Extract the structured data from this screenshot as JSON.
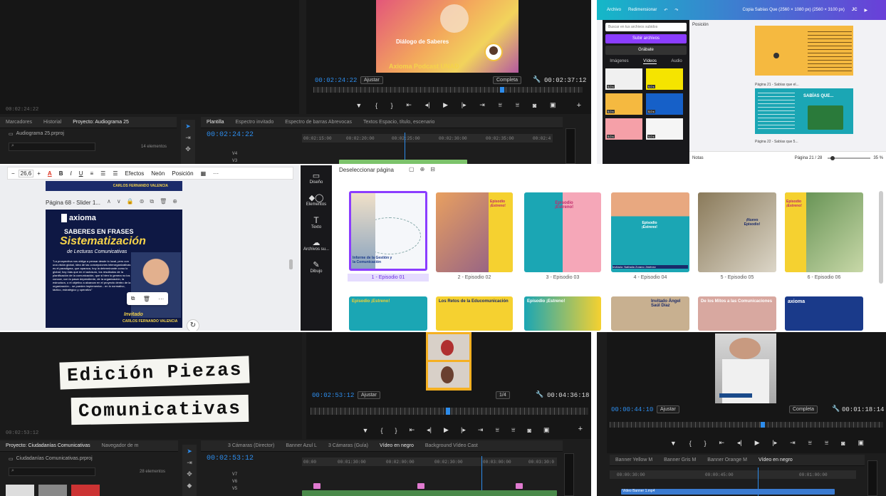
{
  "p1": {
    "program_time": "00:02:24:22",
    "program_title": "Diálogo de Saberes",
    "program_subtitle": "Axioma Podcast UNAD",
    "fit": "Ajustar",
    "quality": "Completa",
    "duration": "00:02:37:12",
    "source_time": "00:02:24:22",
    "tabs": [
      "Marcadores",
      "Historial",
      "Proyecto: Audiograma 25",
      "Plantilla",
      "Espectro invitado",
      "Espectro de barras Abrevocas",
      "Textos Espacio, título, escenario"
    ],
    "project_file": "Audiograma 25.prproj",
    "items": "14 elementos",
    "timeline_time": "00:02:24:22",
    "ruler": [
      "00:02:15:00",
      "00:02:20:00",
      "00:02:25:00",
      "00:02:30:00",
      "00:02:35:00",
      "00:02:4"
    ],
    "tracks": [
      "V4",
      "V3"
    ]
  },
  "p2": {
    "menu": [
      "Archivo",
      "Redimensionar"
    ],
    "doc_title": "Copia Sabías Que (2560 × 1080 px) (2560 × 3100 px)",
    "user": "JC",
    "search_placeholder": "Buscar en tus archivos subidos",
    "upload": "Subir archivos",
    "record": "Grábate",
    "tabs": [
      "Imágenes",
      "Vídeos",
      "Audio"
    ],
    "panel_label": "Posición",
    "badges": [
      "5,0 s",
      "5,0 s",
      "5,0 s",
      "5,0 s",
      "5,0 s",
      "5,0 s"
    ],
    "page21": "Página 21 - Sabías que el...",
    "page22": "Página 22 - Sabías que 5...",
    "sabias": "SABÍAS QUE...",
    "notes": "Notas",
    "pager": "Página 21 / 28",
    "zoom": "35 %"
  },
  "p3": {
    "font_size": "26,6",
    "toolbar": [
      "Efectos",
      "Neón",
      "Posición"
    ],
    "page_label": "Página 68 - Slider 1...",
    "name_banner": "CARLOS FERNANDO VALENCIA",
    "brand": "axioma",
    "heading1": "SABERES EN FRASES",
    "heading2": "Sistematización",
    "heading3": "de Lecturas Comunicativas",
    "body": "\"La prospectiva nos obliga a pensar desde lo local, pero con una visión global, idea de las concepciones interorganizativas es el paradigma, que aparaca, hoy la determinante como lo global; hoy más que en el autosuro, los resultados de la planificación de la comunicación, que si bien lo genera no los conoce, con lo pasar dependiente, de la organización, la estructura, o el objetivo a alcanzar en el proyecto dentro de la organización... se pueden implementar... en lo normativo, táctico, estratégico y operativo\"",
    "invitado": "Invitado",
    "invitado_name": "CARLOS FERNANDO VALENCIA"
  },
  "p4": {
    "top": "Deseleccionar página",
    "side": [
      "Diseño",
      "Elementos",
      "Texto",
      "Archivos su...",
      "Dibujo"
    ],
    "episodes": [
      "1 - Episodio 01",
      "2 - Episodio 02",
      "3 - Episodio 03",
      "4 - Episodio 04",
      "5 - Episodio 05",
      "6 - Episodio 06"
    ],
    "ep1_text": "Informe de la Gestión y la Comunicación",
    "ep2_text": "Episodio ¡Estreno!",
    "ep3_text": "Episodio ¡Estreno!",
    "ep4_text": "Episodio ¡Estreno!",
    "ep4_guest": "Invitado: Nathalia Zorano Jiménez",
    "ep5_text": "¡Nuevo Episodio!",
    "ep6_text": "Episodio ¡Estreno!",
    "row2": [
      "Episodio ¡Estreno!",
      "Los Retos de la Educomunicación",
      "Episodio ¡Estreno!",
      "Invitado Ángel Saúl Díaz",
      "De los Mitos a las Comunicaciones",
      "axioma"
    ]
  },
  "p5": {
    "title_line1": "Edición Piezas",
    "title_line2": "Comunicativas",
    "program_time": "00:02:53:12",
    "fit": "Ajustar",
    "quality": "1/4",
    "duration": "00:04:36:18",
    "source_time": "00:02:53:12",
    "tabs": [
      "Proyecto: Ciudadanías Comunicativas",
      "Navegador de m",
      "3 Cámaras (Director)",
      "Banner Azul L",
      "3 Cámaras (Guía)",
      "Vídeo en negro",
      "Background Vídeo Cast"
    ],
    "project_file": "Ciudadanías Comunicativas.prproj",
    "items": "28 elementos",
    "timeline_time": "00:02:53:12",
    "ruler": [
      "00:00",
      "00:01:30:00",
      "00:02:00:00",
      "00:02:30:00",
      "00:03:00:00",
      "00:03:30:0"
    ],
    "tracks": [
      "V7",
      "V6",
      "V5"
    ]
  },
  "p6": {
    "program_time": "00:00:44:10",
    "fit": "Ajustar",
    "quality": "Completa",
    "duration": "00:01:18:14",
    "tabs": [
      "Banner Yellow M",
      "Banner Gris M",
      "Banner Orange M",
      "Vídeo en negro"
    ],
    "ruler": [
      "00:00:30:00",
      "00:00:45:00",
      "00:01:00:00"
    ],
    "clip": "Video Banner 1.mp4"
  }
}
